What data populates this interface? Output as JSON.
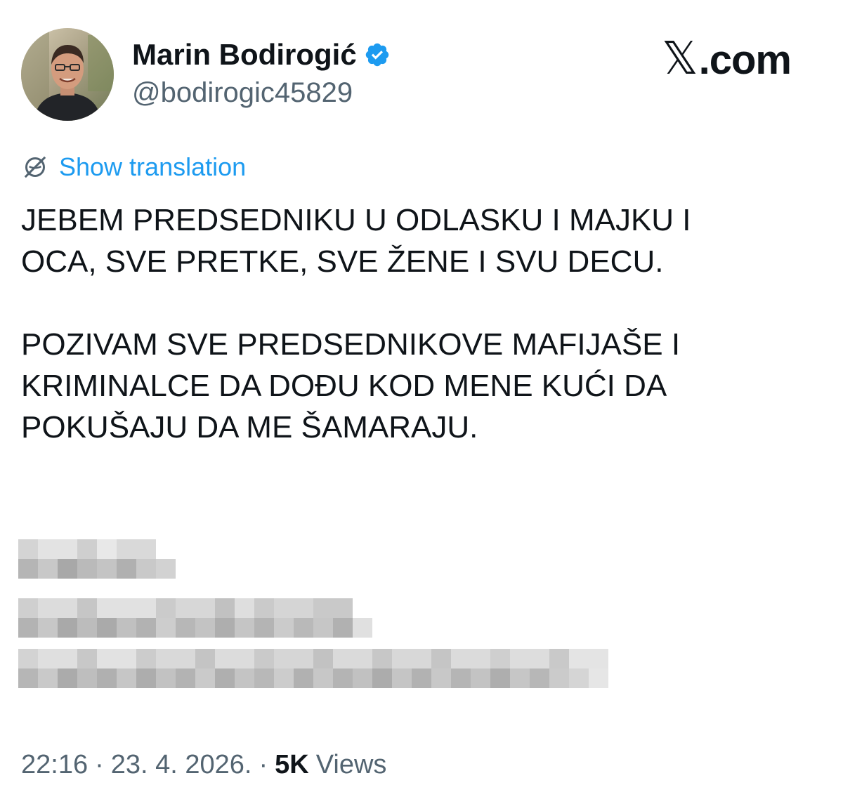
{
  "author": {
    "display_name": "Marin Bodirogić",
    "handle": "@bodirogic45829",
    "verified": true,
    "verified_color": "#1d9bf0"
  },
  "brand": {
    "mark": "𝕏",
    "domain": ".com"
  },
  "translation": {
    "label": "Show translation",
    "icon": "globe-slash-icon",
    "color": "#1d9bf0"
  },
  "tweet": {
    "text": "JEBEM PREDSEDNIKU U ODLASKU I MAJKU I\nOCA, SVE PRETKE, SVE ŽENE I SVU DECU.\n\nPOZIVAM SVE PREDSEDNIKOVE MAFIJAŠE I\nKRIMINALCE DA DOĐU KOD MENE KUĆI DA\nPOKUŠAJU DA ME ŠAMARAJU."
  },
  "meta": {
    "time": "22:16",
    "date": "23. 4. 2026.",
    "separator": "·",
    "views_count": "5K",
    "views_label": "Views"
  }
}
